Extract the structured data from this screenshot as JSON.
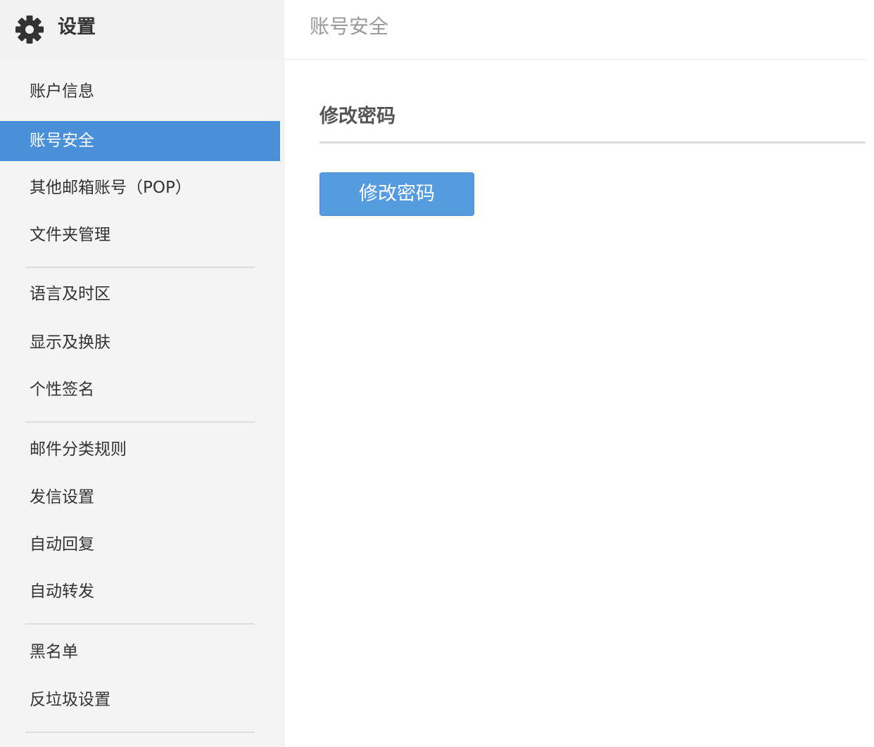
{
  "sidebar": {
    "title": "设置",
    "icon": "gear-icon",
    "items": [
      {
        "label": "账户信息",
        "active": false
      },
      {
        "label": "账号安全",
        "active": true
      },
      {
        "label": "其他邮箱账号（POP）",
        "active": false
      },
      {
        "label": "文件夹管理",
        "active": false
      },
      {
        "label": "语言及时区",
        "active": false
      },
      {
        "label": "显示及换肤",
        "active": false
      },
      {
        "label": "个性签名",
        "active": false
      },
      {
        "label": "邮件分类规则",
        "active": false
      },
      {
        "label": "发信设置",
        "active": false
      },
      {
        "label": "自动回复",
        "active": false
      },
      {
        "label": "自动转发",
        "active": false
      },
      {
        "label": "黑名单",
        "active": false
      },
      {
        "label": "反垃圾设置",
        "active": false
      }
    ]
  },
  "main": {
    "breadcrumb": "账号安全",
    "section_title": "修改密码",
    "change_password_button": "修改密码"
  },
  "colors": {
    "accent": "#4a90d9",
    "button": "#559be0",
    "sidebar_bg": "#f4f4f4"
  }
}
